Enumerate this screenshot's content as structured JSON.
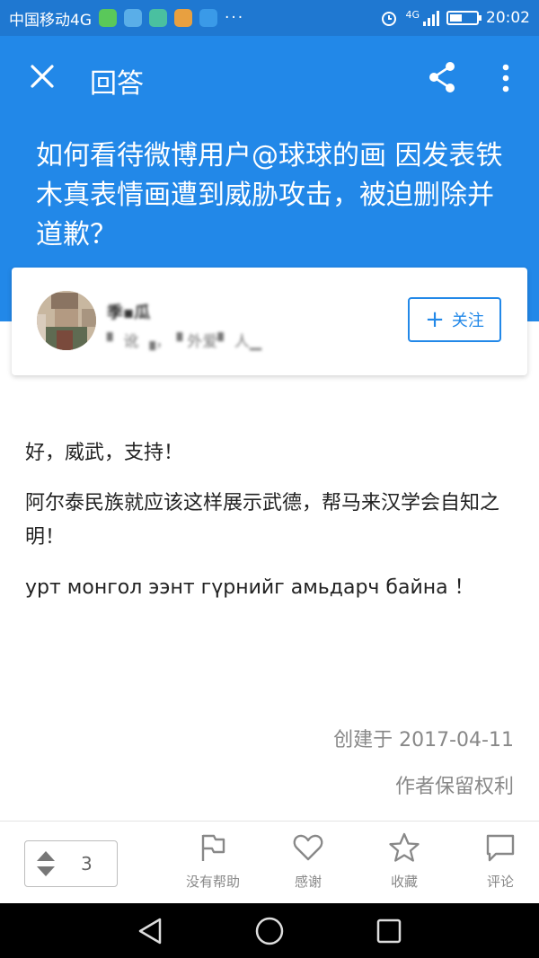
{
  "status_bar": {
    "carrier": "中国移动4G",
    "dots": "···",
    "network": "4G",
    "battery_percent": 45,
    "time": "20:02"
  },
  "toolbar": {
    "title": "回答"
  },
  "question": {
    "title": "如何看待微博用户@球球的画 因发表铁木真表情画遭到威胁攻击，被迫删除并道歉？"
  },
  "author": {
    "name": "季▪︎瓜",
    "bio": "▘ 讹 ▗，▝ 外爱▘ 人▁",
    "follow_label": "关注"
  },
  "answer": {
    "paragraphs": [
      "好，威武，支持！",
      "阿尔泰民族就应该这样展示武德，帮马来汉学会自知之明！",
      "урт монгол ээнт гүрнийг амьдарч байна ！"
    ],
    "created": "创建于 2017-04-11",
    "rights": "作者保留权利"
  },
  "actions": {
    "vote_count": "3",
    "items": [
      {
        "label": "没有帮助",
        "icon": "flag-icon"
      },
      {
        "label": "感谢",
        "icon": "heart-icon"
      },
      {
        "label": "收藏",
        "icon": "star-icon"
      },
      {
        "label": "评论",
        "icon": "comment-icon"
      }
    ]
  },
  "colors": {
    "primary": "#2288e8",
    "status_bar": "#1f78d1"
  }
}
